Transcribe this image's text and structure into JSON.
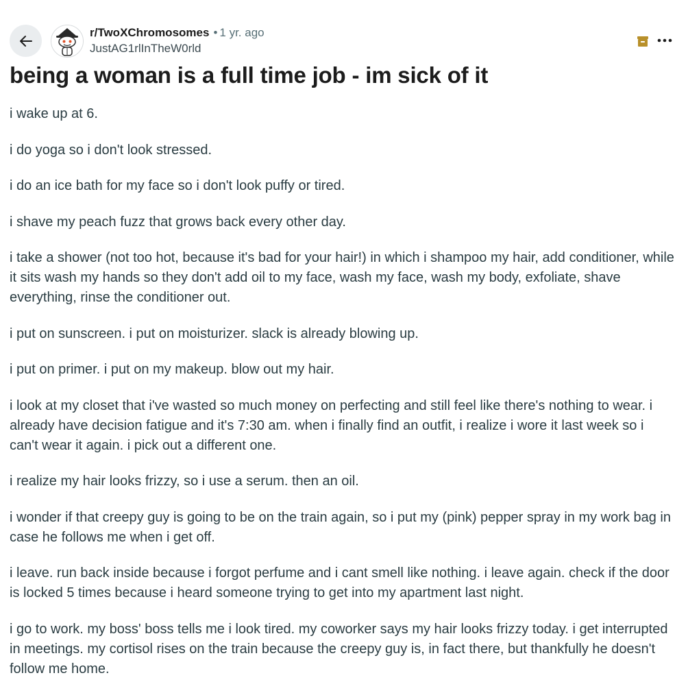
{
  "post": {
    "subreddit": "r/TwoXChromosomes",
    "separator": "•",
    "age": "1 yr. ago",
    "author": "JustAG1rlInTheW0rld",
    "title": "being a woman is a full time job - im sick of it",
    "paragraphs": [
      "i wake up at 6.",
      "i do yoga so i don't look stressed.",
      "i do an ice bath for my face so i don't look puffy or tired.",
      "i shave my peach fuzz that grows back every other day.",
      "i take a shower (not too hot, because it's bad for your hair!) in which i shampoo my hair, add conditioner, while it sits wash my hands so they don't add oil to my face, wash my face, wash my body, exfoliate, shave everything, rinse the conditioner out.",
      "i put on sunscreen. i put on moisturizer. slack is already blowing up.",
      "i put on primer. i put on my makeup. blow out my hair.",
      "i look at my closet that i've wasted so much money on perfecting and still feel like there's nothing to wear. i already have decision fatigue and it's 7:30 am. when i finally find an outfit, i realize i wore it last week so i can't wear it again. i pick out a different one.",
      "i realize my hair looks frizzy, so i use a serum. then an oil.",
      "i wonder if that creepy guy is going to be on the train again, so i put my (pink) pepper spray in my work bag in case he follows me when i get off.",
      "i leave. run back inside because i forgot perfume and i cant smell like nothing. i leave again. check if the door is locked 5 times because i heard someone trying to get into my apartment last night.",
      "i go to work. my boss' boss tells me i look tired. my coworker says my hair looks frizzy today. i get interrupted in meetings. my cortisol rises on the train because the creepy guy is, in fact there, but thankfully he doesn't follow me home."
    ]
  },
  "icons": {
    "back": "arrow-left-icon",
    "avatar": "subreddit-snoo-avatar",
    "archive": "archive-box-icon",
    "more": "more-options-icon"
  },
  "colors": {
    "archive_icon": "#b8902a",
    "back_button_bg": "#eaedef",
    "meta_grey": "#576f76",
    "body_text": "#2a3c42"
  }
}
